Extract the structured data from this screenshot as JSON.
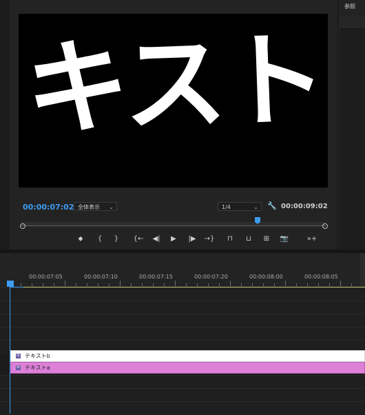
{
  "program_monitor": {
    "preview_text": "キスト",
    "current_timecode": "00:00:07:02",
    "zoom_select": "全体表示",
    "resolution_select": "1/4",
    "total_timecode": "00:00:09:02",
    "transport": [
      {
        "name": "add-marker-button",
        "glyph": "⬥"
      },
      {
        "name": "mark-in-button",
        "glyph": "{"
      },
      {
        "name": "mark-out-button",
        "glyph": "}"
      },
      {
        "name": "go-to-in-button",
        "glyph": "{←"
      },
      {
        "name": "step-back-button",
        "glyph": "◀|"
      },
      {
        "name": "play-button",
        "glyph": "▶"
      },
      {
        "name": "step-forward-button",
        "glyph": "|▶"
      },
      {
        "name": "go-to-out-button",
        "glyph": "→}"
      },
      {
        "name": "lift-button",
        "glyph": "⊓"
      },
      {
        "name": "extract-button",
        "glyph": "⊔"
      },
      {
        "name": "compare-button",
        "glyph": "⊞"
      },
      {
        "name": "export-frame-button",
        "glyph": "📷"
      },
      {
        "name": "button-editor-button",
        "glyph": "»+"
      }
    ]
  },
  "right_panel": {
    "tab": "参照"
  },
  "timeline": {
    "ruler_labels": [
      "00:00:07:05",
      "00:00:07:10",
      "00:00:07:15",
      "00:00:07:20",
      "00:00:08:00",
      "00:00:08:05"
    ],
    "clips": [
      {
        "label": "テキストb",
        "color": "#ffffff"
      },
      {
        "label": "テキストa",
        "color": "#dd80d8"
      }
    ]
  },
  "colors": {
    "accent": "#3d9bf0",
    "work_area": "#c7c36e"
  }
}
